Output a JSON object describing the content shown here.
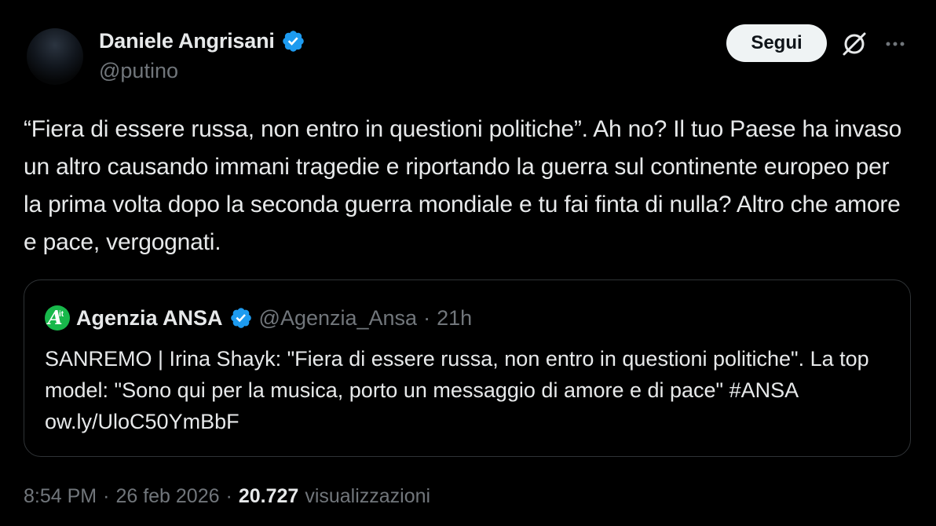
{
  "author": {
    "name": "Daniele Angrisani",
    "handle": "@putino",
    "verified": true
  },
  "actions": {
    "follow_label": "Segui",
    "grok_icon": "grok-icon",
    "more_icon": "more-icon"
  },
  "tweet": {
    "text": "“Fiera di essere russa, non entro in questioni politiche”. Ah no? Il tuo Paese ha invaso un altro causando immani tragedie e riportando la guerra sul continente europeo per la prima volta dopo la seconda guerra mondiale e tu fai finta di nulla? Altro che amore e pace, vergognati."
  },
  "quote": {
    "name": "Agenzia ANSA",
    "handle": "@Agenzia_Ansa",
    "separator": "·",
    "time": "21h",
    "logo_text": "A",
    "logo_sub": "it",
    "text": "SANREMO | Irina Shayk: \"Fiera di essere russa, non entro in questioni politiche\". La top model: \"Sono qui per la musica, porto un messaggio di amore e di pace\" #ANSA ow.ly/UloC50YmBbF"
  },
  "meta": {
    "time": "8:54 PM",
    "date": "26 feb 2026",
    "views_count": "20.727",
    "views_label": "visualizzazioni",
    "separator": "·"
  },
  "colors": {
    "background": "#000000",
    "text_primary": "#e7e9ea",
    "text_secondary": "#71767b",
    "verified_blue": "#1d9bf0",
    "border": "#2f3336",
    "follow_bg": "#eff3f4",
    "ansa_green": "#18b84b"
  }
}
